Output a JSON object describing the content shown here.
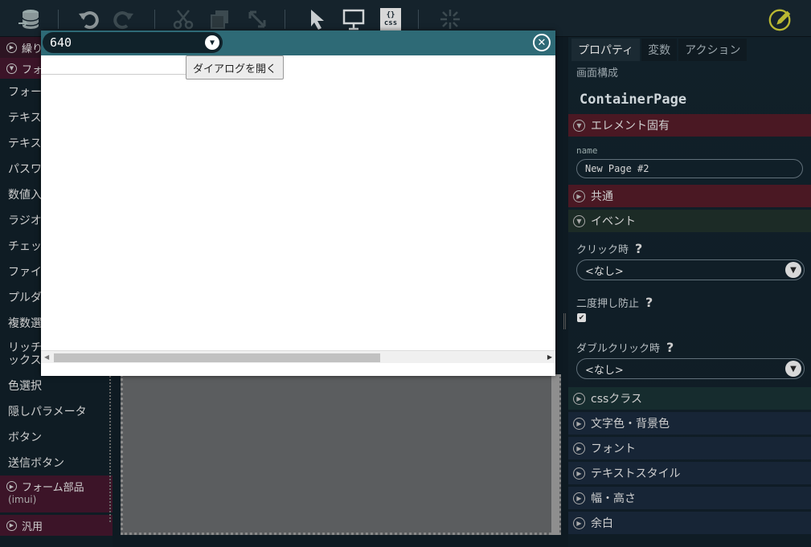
{
  "toolbar": {
    "icons": [
      "database-icon",
      "undo-icon",
      "redo-icon",
      "cut-icon",
      "copy-icon",
      "move-icon",
      "pointer-icon",
      "preview-icon",
      "css-icon",
      "sparkle-icon",
      "edit-icon"
    ],
    "css_label": "css"
  },
  "left_panel": {
    "top_section": "繰り",
    "form_section": "フォ",
    "items": [
      "フォー",
      "テキス",
      "テキス",
      "パスワ",
      "数値入",
      "ラジオ",
      "チェッ",
      "ファイ",
      "プルダ",
      "複数選"
    ],
    "rich_text": "リッチ",
    "rich_text_2": "ックス",
    "items2": [
      "色選択",
      "隠しパラメータ",
      "ボタン",
      "送信ボタン"
    ],
    "form_parts_section": "フォーム部品",
    "form_parts_sub": "(imui)",
    "general_section": "汎用"
  },
  "dialog": {
    "width_value": "640",
    "open_button": "ダイアログを開く"
  },
  "right_panel": {
    "tabs": [
      "プロパティ",
      "変数",
      "アクション"
    ],
    "subtab": "画面構成",
    "component_name": "ContainerPage",
    "sections": {
      "element": "エレメント固有",
      "common": "共通",
      "event": "イベント",
      "css_class": "cssクラス",
      "color": "文字色・背景色",
      "font": "フォント",
      "text_style": "テキストスタイル",
      "size": "幅・高さ",
      "margin": "余白"
    },
    "name_label": "name",
    "name_value": "New Page #2",
    "click_label": "クリック時",
    "click_value": "<なし>",
    "double_press_label": "二度押し防止",
    "double_click_label": "ダブルクリック時",
    "double_click_value": "<なし>",
    "help_glyph": "?"
  }
}
